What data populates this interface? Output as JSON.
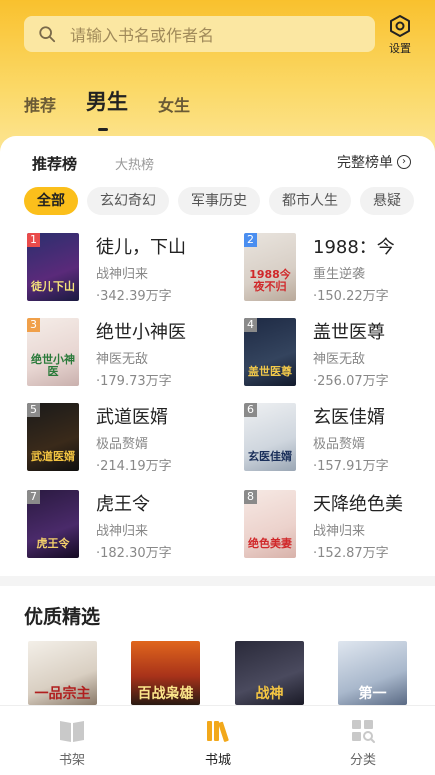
{
  "search": {
    "placeholder": "请输入书名或作者名"
  },
  "settings": {
    "label": "设置"
  },
  "gender_tabs": [
    "推荐",
    "男生",
    "女生"
  ],
  "ranking": {
    "tabs": [
      "推荐榜",
      "大热榜"
    ],
    "full_list_label": "完整榜单",
    "categories": [
      "全部",
      "玄幻奇幻",
      "军事历史",
      "都市人生",
      "悬疑"
    ],
    "books": [
      {
        "rank": "1",
        "title": "徒儿，下山",
        "genre": "战神归来",
        "words": "·342.39万字",
        "cover_text": "徒儿下山"
      },
      {
        "rank": "2",
        "title": "1988：今",
        "genre": "重生逆袭",
        "words": "·150.22万字",
        "cover_text": "1988今夜不归"
      },
      {
        "rank": "3",
        "title": "绝世小神医",
        "genre": "神医无敌",
        "words": "·179.73万字",
        "cover_text": "绝世小神医"
      },
      {
        "rank": "4",
        "title": "盖世医尊",
        "genre": "神医无敌",
        "words": "·256.07万字",
        "cover_text": "盖世医尊"
      },
      {
        "rank": "5",
        "title": "武道医婿",
        "genre": "极品赘婿",
        "words": "·214.19万字",
        "cover_text": "武道医婿"
      },
      {
        "rank": "6",
        "title": "玄医佳婿",
        "genre": "极品赘婿",
        "words": "·157.91万字",
        "cover_text": "玄医佳婿"
      },
      {
        "rank": "7",
        "title": "虎王令",
        "genre": "战神归来",
        "words": "·182.30万字",
        "cover_text": "虎王令"
      },
      {
        "rank": "8",
        "title": "天降绝色美",
        "genre": "战神归来",
        "words": "·152.87万字",
        "cover_text": "绝色美妻"
      }
    ]
  },
  "quality": {
    "title": "优质精选",
    "picks": [
      {
        "cover_text": "一品宗主"
      },
      {
        "cover_text": "百战枭雄"
      },
      {
        "cover_text": "战神"
      },
      {
        "cover_text": "第一"
      }
    ]
  },
  "bottom_nav": [
    {
      "label": "书架"
    },
    {
      "label": "书城"
    },
    {
      "label": "分类"
    }
  ],
  "colors": {
    "accent": "#fbbf1b",
    "header": "#f9c12e"
  }
}
